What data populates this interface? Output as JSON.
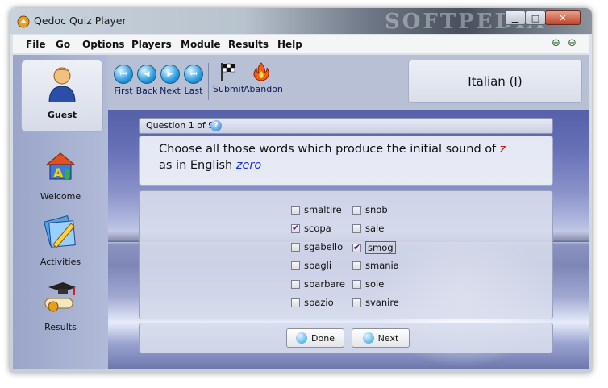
{
  "window": {
    "title": "Qedoc Quiz Player",
    "watermark": "SOFTPEDIA"
  },
  "menu": [
    "File",
    "Go",
    "Options",
    "Players",
    "Module",
    "Results",
    "Help"
  ],
  "user": {
    "name": "Guest"
  },
  "sidebar": {
    "items": [
      {
        "label": "Welcome"
      },
      {
        "label": "Activities"
      },
      {
        "label": "Results"
      }
    ]
  },
  "toolbar": {
    "first": "First",
    "back": "Back",
    "next": "Next",
    "last": "Last",
    "submit": "Submit",
    "abandon": "Abandon"
  },
  "module": {
    "title": "Italian (I)"
  },
  "question": {
    "header": "Question 1 of 9.",
    "text_part1": "Choose all those words which produce the initial sound of",
    "highlight_letter": "z",
    "text_part2": "as in English",
    "example_word": "zero"
  },
  "options": [
    {
      "label": "smaltire",
      "checked": false
    },
    {
      "label": "snob",
      "checked": false
    },
    {
      "label": "scopa",
      "checked": true
    },
    {
      "label": "sale",
      "checked": false
    },
    {
      "label": "sgabello",
      "checked": false
    },
    {
      "label": "smog",
      "checked": true
    },
    {
      "label": "sbagli",
      "checked": false
    },
    {
      "label": "smania",
      "checked": false
    },
    {
      "label": "sbarbare",
      "checked": false
    },
    {
      "label": "sole",
      "checked": false
    },
    {
      "label": "spazio",
      "checked": false
    },
    {
      "label": "svanire",
      "checked": false
    }
  ],
  "footer": {
    "done": "Done",
    "next": "Next"
  },
  "colors": {
    "accent_red": "#d01010",
    "accent_blue": "#1a2fd0"
  }
}
